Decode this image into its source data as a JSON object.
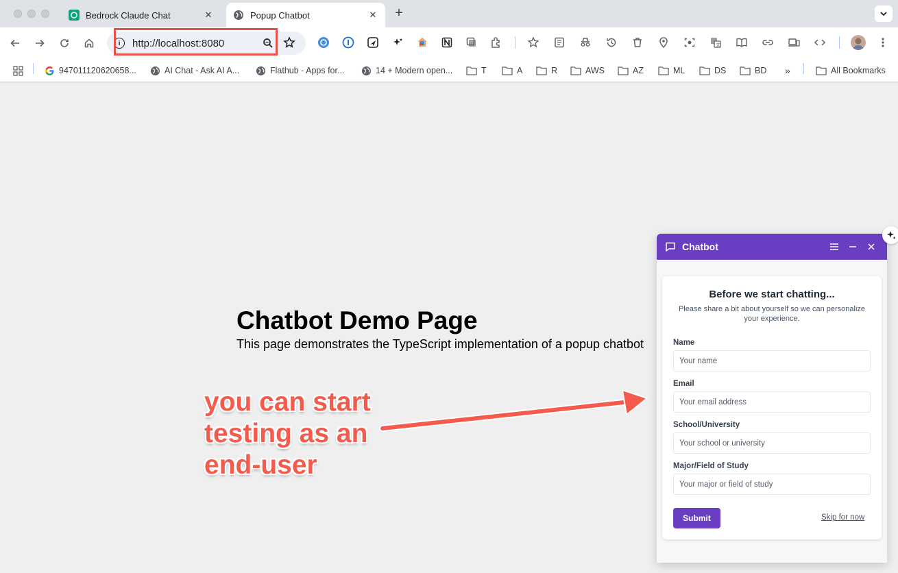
{
  "browser": {
    "tabs": [
      {
        "title": "Bedrock Claude Chat",
        "active": false
      },
      {
        "title": "Popup Chatbot",
        "active": true
      }
    ],
    "address_bar": {
      "url": "http://localhost:8080"
    },
    "bookmarks": [
      {
        "label": "947011120620658...",
        "icon": "google-icon"
      },
      {
        "label": "AI Chat - Ask AI A...",
        "icon": "globe-icon"
      },
      {
        "label": "Flathub - Apps for...",
        "icon": "globe-icon"
      },
      {
        "label": "14 + Modern open...",
        "icon": "globe-icon"
      },
      {
        "label": "T",
        "icon": "folder-icon"
      },
      {
        "label": "A",
        "icon": "folder-icon"
      },
      {
        "label": "R",
        "icon": "folder-icon"
      },
      {
        "label": "AWS",
        "icon": "folder-icon"
      },
      {
        "label": "AZ",
        "icon": "folder-icon"
      },
      {
        "label": "ML",
        "icon": "folder-icon"
      },
      {
        "label": "DS",
        "icon": "folder-icon"
      },
      {
        "label": "BD",
        "icon": "folder-icon"
      }
    ],
    "overflow_label": "»",
    "all_bookmarks_label": "All Bookmarks"
  },
  "page": {
    "title": "Chatbot Demo Page",
    "description": "This page demonstrates the TypeScript implementation of a popup chatbot"
  },
  "annotation": {
    "line1": "you can start",
    "line2": "testing as an",
    "line3": "end-user",
    "color": "#f35b4d"
  },
  "chatbot": {
    "header_title": "Chatbot",
    "accent_color": "#6a3ec3",
    "form": {
      "title": "Before we start chatting...",
      "subtitle": "Please share a bit about yourself so we can personalize your experience.",
      "fields": [
        {
          "label": "Name",
          "placeholder": "Your name"
        },
        {
          "label": "Email",
          "placeholder": "Your email address"
        },
        {
          "label": "School/University",
          "placeholder": "Your school or university"
        },
        {
          "label": "Major/Field of Study",
          "placeholder": "Your major or field of study"
        }
      ],
      "submit_label": "Submit",
      "skip_label": "Skip for now"
    }
  }
}
